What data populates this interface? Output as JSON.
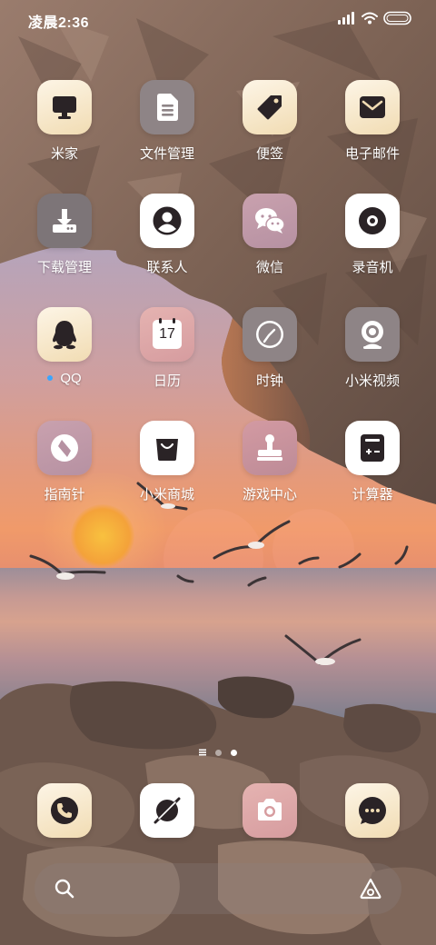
{
  "status_bar": {
    "time": "凌晨2:36"
  },
  "apps": [
    {
      "label": "米家",
      "icon": "monitor-icon"
    },
    {
      "label": "文件管理",
      "icon": "document-icon"
    },
    {
      "label": "便签",
      "icon": "tag-icon"
    },
    {
      "label": "电子邮件",
      "icon": "mail-icon"
    },
    {
      "label": "下载管理",
      "icon": "download-icon"
    },
    {
      "label": "联系人",
      "icon": "person-icon"
    },
    {
      "label": "微信",
      "icon": "chat-bubbles-icon"
    },
    {
      "label": "录音机",
      "icon": "record-icon"
    },
    {
      "label": "QQ",
      "icon": "penguin-icon"
    },
    {
      "label": "日历",
      "icon": "calendar-icon",
      "calendar_day": "17"
    },
    {
      "label": "时钟",
      "icon": "clock-icon"
    },
    {
      "label": "小米视频",
      "icon": "webcam-icon"
    },
    {
      "label": "指南针",
      "icon": "compass-icon"
    },
    {
      "label": "小米商城",
      "icon": "shopping-bag-icon"
    },
    {
      "label": "游戏中心",
      "icon": "joystick-icon"
    },
    {
      "label": "计算器",
      "icon": "calculator-icon"
    }
  ],
  "dock": [
    {
      "icon": "phone-icon"
    },
    {
      "icon": "browser-icon"
    },
    {
      "icon": "camera-icon"
    },
    {
      "icon": "message-icon"
    }
  ],
  "search_bar": {
    "left_icon": "search-icon",
    "right_icon": "assistant-icon"
  },
  "colors": {
    "icon_glyph": "#2a2326",
    "label_text": "#ffffff",
    "notification_dot": "#3ba5ff"
  }
}
